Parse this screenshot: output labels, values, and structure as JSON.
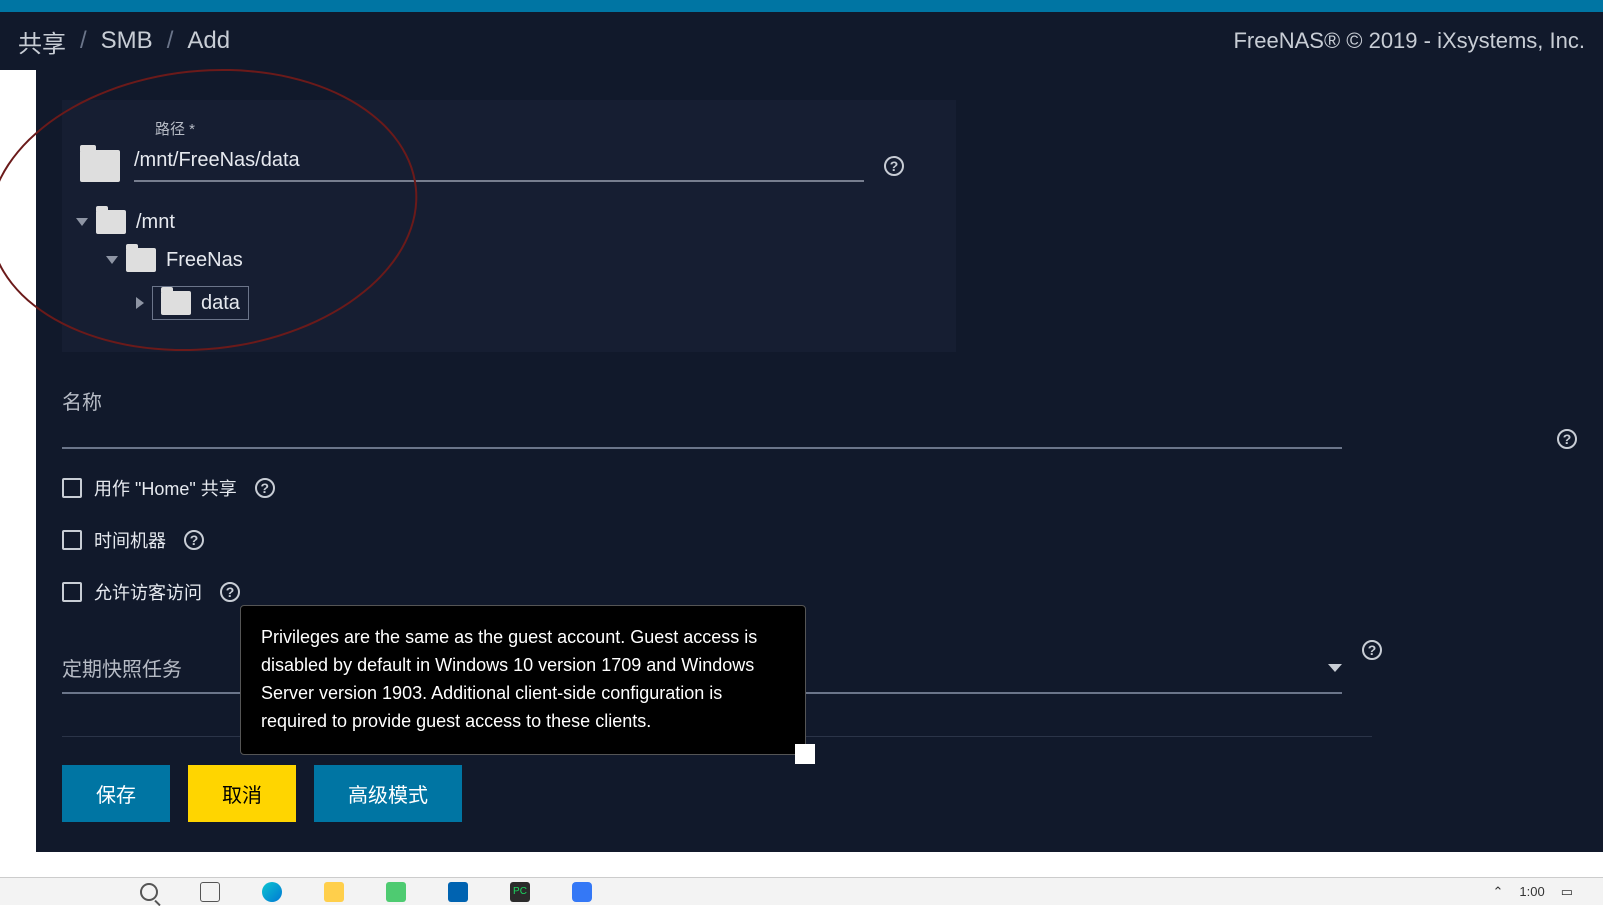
{
  "breadcrumb": {
    "item1": "共享",
    "item2": "SMB",
    "item3": "Add"
  },
  "copyright": "FreeNAS® © 2019 - iXsystems, Inc.",
  "path": {
    "label": "路径 *",
    "value": "/mnt/FreeNas/data"
  },
  "tree": {
    "node1": "/mnt",
    "node2": "FreeNas",
    "node3": "data"
  },
  "fields": {
    "name_label": "名称",
    "home_share": "用作 \"Home\" 共享",
    "time_machine": "时间机器",
    "guest_access": "允许访客访问",
    "snapshot_task": "定期快照任务"
  },
  "tooltip": {
    "text": "Privileges are the same as the guest account. Guest access is disabled by default in Windows 10 version 1709 and Windows Server version 1903. Additional client-side configuration is required to provide guest access to these clients."
  },
  "buttons": {
    "save": "保存",
    "cancel": "取消",
    "advanced": "高级模式"
  },
  "taskbar": {
    "time": "1:00"
  }
}
